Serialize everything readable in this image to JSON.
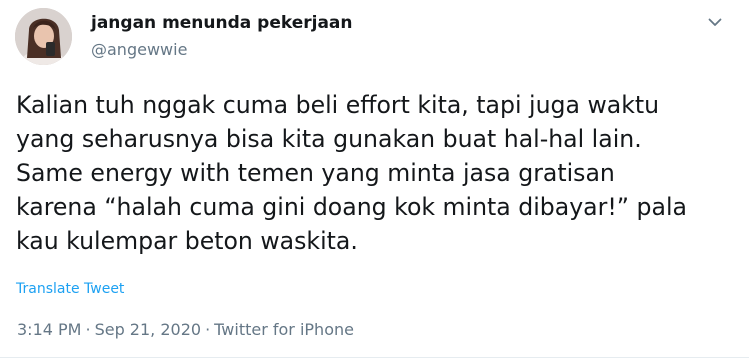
{
  "user": {
    "display_name": "jangan menunda pekerjaan",
    "handle": "@angewwie"
  },
  "tweet": {
    "text": "Kalian tuh nggak cuma beli effort kita, tapi juga waktu\nyang seharusnya bisa kita gunakan buat hal-hal lain.\nSame energy with temen yang minta jasa gratisan\nkarena “halah cuma gini doang kok minta dibayar!” pala\nkau kulempar beton waskita.",
    "translate_label": "Translate Tweet",
    "time": "3:14 PM",
    "date": "Sep 21, 2020",
    "separator": "·",
    "source": "Twitter for iPhone"
  },
  "icons": {
    "caret": "chevron-down-icon",
    "avatar": "profile-photo"
  },
  "colors": {
    "text_primary": "#14171a",
    "text_secondary": "#657786",
    "link": "#1da1f2"
  }
}
